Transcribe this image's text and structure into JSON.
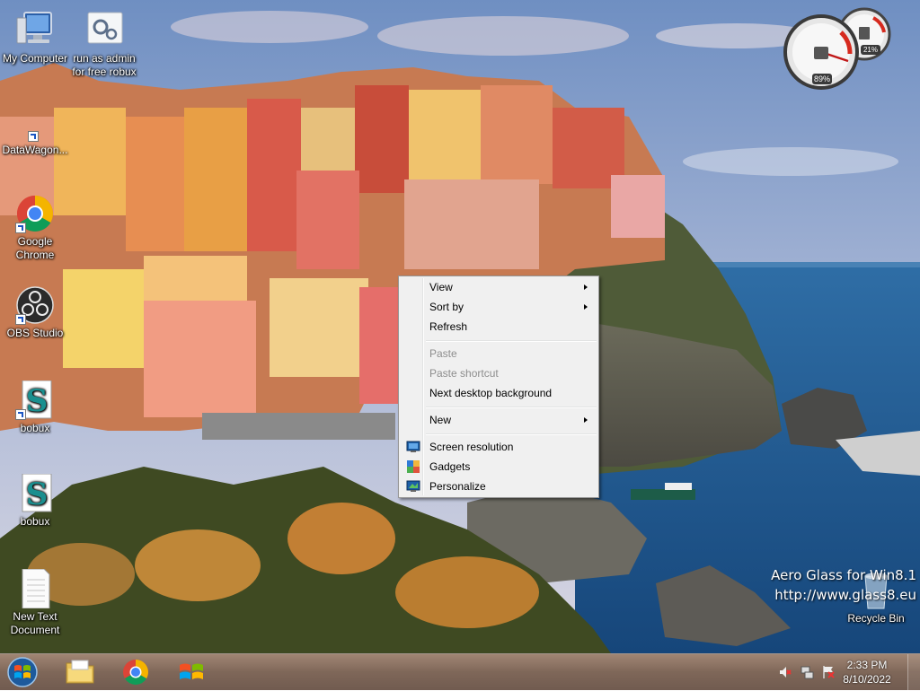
{
  "desktop": {
    "icons": [
      {
        "label": "My Computer"
      },
      {
        "label": "run as admin for free robux"
      },
      {
        "label": "DataWagon..."
      },
      {
        "label": "Google Chrome"
      },
      {
        "label": "OBS Studio"
      },
      {
        "label": "bobux"
      },
      {
        "label": "bobux"
      },
      {
        "label": "New Text Document"
      },
      {
        "label": "Recycle Bin"
      }
    ]
  },
  "gadget": {
    "cpu_percent": "89%",
    "memory_percent": "21%"
  },
  "watermark": {
    "line1": "Aero Glass for Win8.1",
    "line2": "http://www.glass8.eu"
  },
  "context_menu": {
    "items": [
      {
        "label": "View",
        "submenu": true,
        "disabled": false
      },
      {
        "label": "Sort by",
        "submenu": true,
        "disabled": false
      },
      {
        "label": "Refresh",
        "submenu": false,
        "disabled": false
      },
      {
        "label": "Paste",
        "submenu": false,
        "disabled": true
      },
      {
        "label": "Paste shortcut",
        "submenu": false,
        "disabled": true
      },
      {
        "label": "Next desktop background",
        "submenu": false,
        "disabled": false
      },
      {
        "label": "New",
        "submenu": true,
        "disabled": false
      },
      {
        "label": "Screen resolution",
        "submenu": false,
        "disabled": false,
        "icon": "screen-resolution-icon"
      },
      {
        "label": "Gadgets",
        "submenu": false,
        "disabled": false,
        "icon": "gadgets-icon"
      },
      {
        "label": "Personalize",
        "submenu": false,
        "disabled": false,
        "icon": "personalize-icon"
      }
    ]
  },
  "taskbar": {
    "pinned": [
      "file-explorer-icon",
      "chrome-icon",
      "windows-update-icon"
    ],
    "tray_icons": [
      "volume-muted-icon",
      "network-icon",
      "action-center-flag-icon"
    ],
    "time": "2:33 PM",
    "date": "8/10/2022"
  },
  "colors": {
    "menu_background": "#f0f0f0",
    "menu_disabled_text": "#8d8d8d",
    "taskbar": "#7a5e50"
  }
}
